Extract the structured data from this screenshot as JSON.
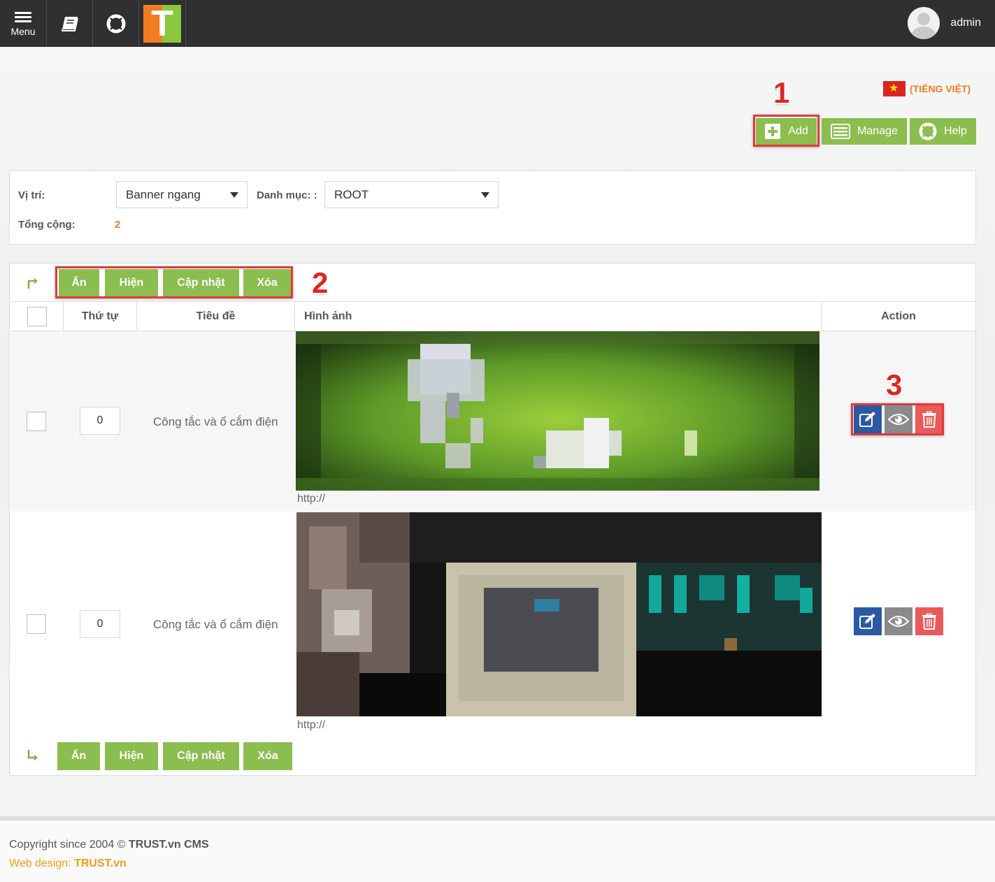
{
  "topbar": {
    "menu_label": "Menu",
    "user_name": "admin"
  },
  "header": {
    "language": "(TIẾNG VIỆT)",
    "add_label": "Add",
    "manage_label": "Manage",
    "help_label": "Help"
  },
  "markers": {
    "m1": "1",
    "m2": "2",
    "m3": "3"
  },
  "filter": {
    "position_label": "Vị trí:",
    "position_value": "Banner ngang",
    "category_label": "Danh mục: :",
    "category_value": "ROOT",
    "total_label": "Tổng cộng:",
    "total_value": "2"
  },
  "bulk_actions": {
    "hide": "Ẩn",
    "show": "Hiện",
    "update": "Cập nhật",
    "delete": "Xóa"
  },
  "table": {
    "headers": {
      "order": "Thứ tự",
      "title": "Tiêu đề",
      "image": "Hình ảnh",
      "action": "Action"
    },
    "rows": [
      {
        "order": "0",
        "title": "Công tắc và ổ cắm điện",
        "url": "http://"
      },
      {
        "order": "0",
        "title": "Công tắc và ổ cắm điện",
        "url": "http://"
      }
    ]
  },
  "footer": {
    "copyright_prefix": "Copyright since 2004 © ",
    "copyright_brand": "TRUST.vn CMS",
    "webdesign_prefix": "Web design: ",
    "webdesign_brand": "TRUST.vn"
  },
  "colors": {
    "green": "#8cbd4f",
    "orange": "#f47c20",
    "topbar": "#2f3032",
    "edit": "#2b5aa3",
    "view": "#8a8a8a",
    "delete": "#ea5a5a",
    "highlight": "#e03a3a"
  },
  "icons": [
    "menu-icon",
    "book-icon",
    "lifebuoy-icon",
    "logo-t",
    "user-avatar-icon",
    "flag-vn-icon",
    "plus-icon",
    "list-icon",
    "edit-icon",
    "eye-icon",
    "trash-icon",
    "arrow-right-icon",
    "arrow-down-right-icon"
  ]
}
